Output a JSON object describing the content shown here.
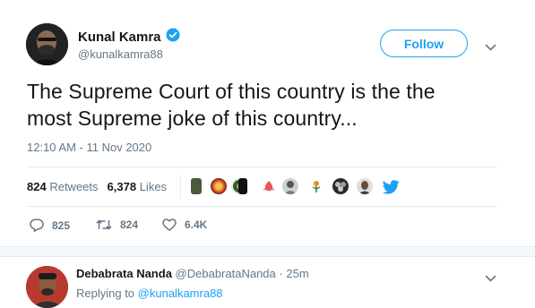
{
  "tweet": {
    "author_name": "Kunal Kamra",
    "author_handle": "@kunalkamra88",
    "follow_label": "Follow",
    "text_line1": "The Supreme Court of this country is the the",
    "text_line2": "most Supreme joke of this country...",
    "timestamp": "12:10 AM - 11 Nov 2020",
    "retweets_count": "824",
    "retweets_label": "Retweets",
    "likes_count": "6,378",
    "likes_label": "Likes",
    "actions": {
      "reply_count": "825",
      "retweet_count": "824",
      "like_count": "6.4K"
    }
  },
  "reply": {
    "author_name": "Debabrata Nanda",
    "author_handle": "@DebabrataNanda",
    "separator": "·",
    "age": "25m",
    "replying_to_label": "Replying to",
    "replying_to_handle": "@kunalkamra88"
  },
  "colors": {
    "accent": "#1da1f2",
    "muted": "#657786",
    "text": "#14171a",
    "divider": "#e6ecf0"
  },
  "icons": [
    "verified-badge-icon",
    "chevron-down-icon",
    "reply-icon",
    "retweet-icon",
    "like-icon",
    "twitter-bird-icon"
  ]
}
